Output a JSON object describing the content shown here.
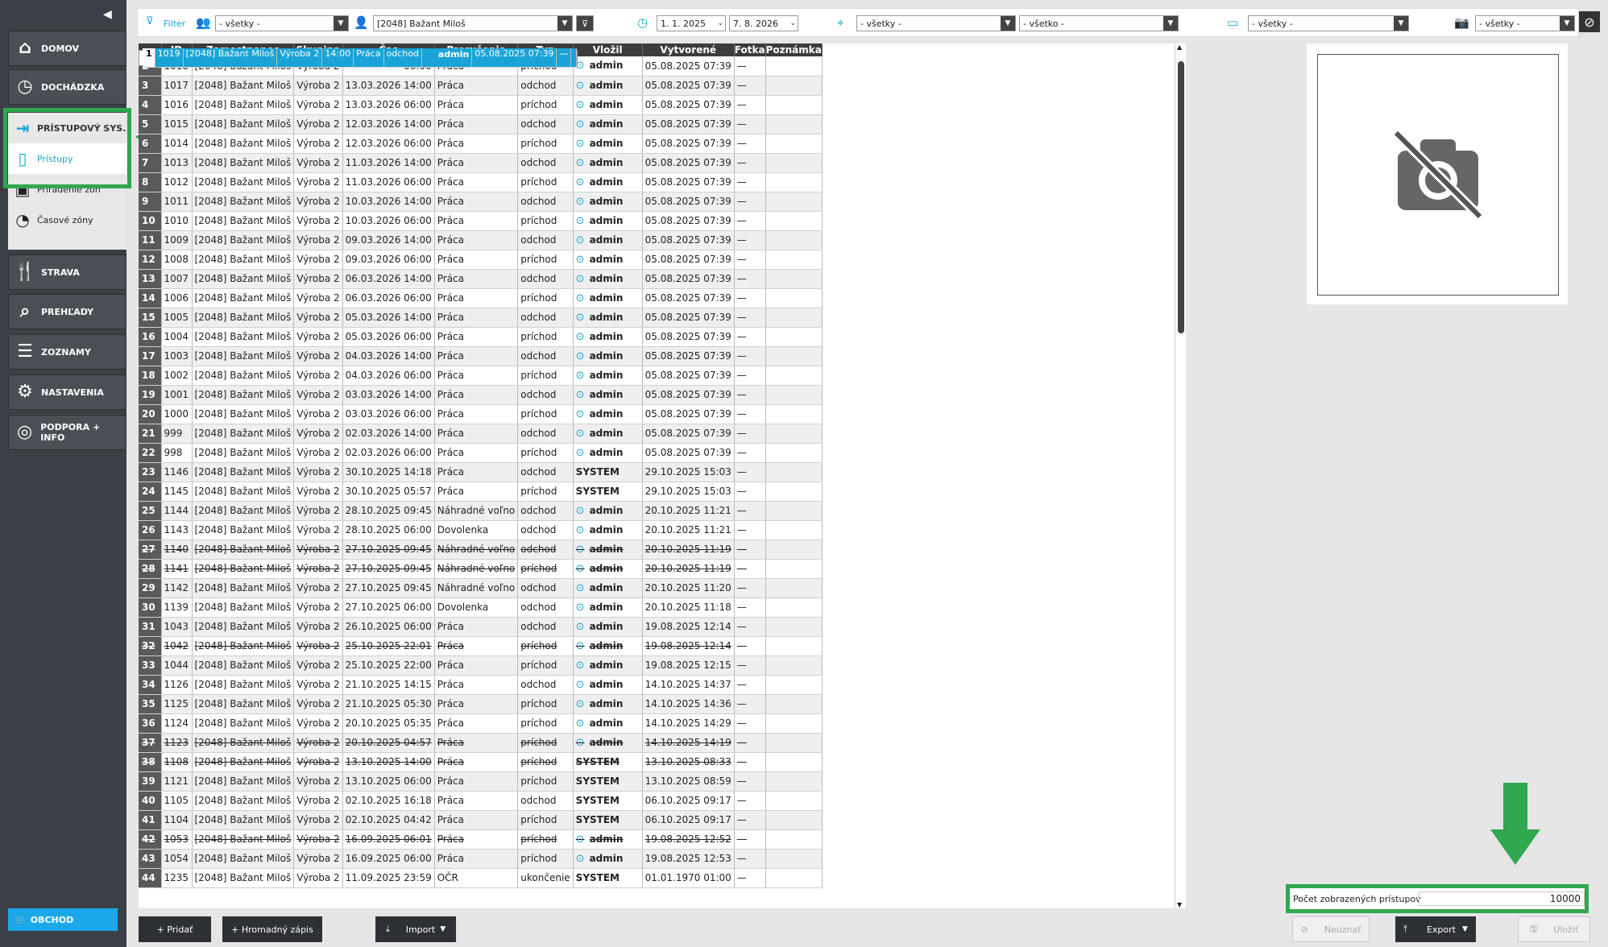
{
  "nav": {
    "domov": "DOMOV",
    "dochadzka": "DOCHÁDZKA",
    "pristupovy": "PRÍSTUPOVÝ SYS.",
    "pristupy": "Prístupy",
    "priradenie": "Priradenie zón",
    "casove": "Časové zóny",
    "strava": "STRAVA",
    "prehlady": "PREHĽADY",
    "zoznamy": "ZOZNAMY",
    "nastavenia": "NASTAVENIA",
    "podpora": "PODPORA + INFO",
    "obchod": "OBCHOD"
  },
  "toolbar": {
    "filter": "Filter",
    "group": "- všetky -",
    "employee": "[2048] Bažant Miloš",
    "date_from": "1. 1. 2025",
    "date_to": "7. 8. 2026",
    "zone1": "- všetky -",
    "zone2": "- všetko -",
    "device": "- všetky -",
    "photo": "- všetky -"
  },
  "columns": [
    "ID",
    "Zamestnanec",
    "Skupina",
    "Čas",
    "Prerušenie",
    "Typ",
    "Vložil",
    "Vytvorené",
    "Fotka",
    "Poznámka"
  ],
  "rows": [
    [
      "1",
      "1019",
      "[2048] Bažant Miloš",
      "Výroba 2",
      "14:00",
      "Práca",
      "odchod",
      "admin",
      "05.08.2025 07:39",
      "—",
      "sel"
    ],
    [
      "2",
      "1018",
      "[2048] Bažant Miloš",
      "Výroba 2",
      "06:00",
      "Práca",
      "príchod",
      "admin",
      "05.08.2025 07:39",
      "—",
      ""
    ],
    [
      "3",
      "1017",
      "[2048] Bažant Miloš",
      "Výroba 2",
      "13.03.2026 14:00",
      "Práca",
      "odchod",
      "admin",
      "05.08.2025 07:39",
      "—",
      ""
    ],
    [
      "4",
      "1016",
      "[2048] Bažant Miloš",
      "Výroba 2",
      "13.03.2026 06:00",
      "Práca",
      "príchod",
      "admin",
      "05.08.2025 07:39",
      "—",
      ""
    ],
    [
      "5",
      "1015",
      "[2048] Bažant Miloš",
      "Výroba 2",
      "12.03.2026 14:00",
      "Práca",
      "odchod",
      "admin",
      "05.08.2025 07:39",
      "—",
      ""
    ],
    [
      "6",
      "1014",
      "[2048] Bažant Miloš",
      "Výroba 2",
      "12.03.2026 06:00",
      "Práca",
      "príchod",
      "admin",
      "05.08.2025 07:39",
      "—",
      ""
    ],
    [
      "7",
      "1013",
      "[2048] Bažant Miloš",
      "Výroba 2",
      "11.03.2026 14:00",
      "Práca",
      "odchod",
      "admin",
      "05.08.2025 07:39",
      "—",
      ""
    ],
    [
      "8",
      "1012",
      "[2048] Bažant Miloš",
      "Výroba 2",
      "11.03.2026 06:00",
      "Práca",
      "príchod",
      "admin",
      "05.08.2025 07:39",
      "—",
      ""
    ],
    [
      "9",
      "1011",
      "[2048] Bažant Miloš",
      "Výroba 2",
      "10.03.2026 14:00",
      "Práca",
      "odchod",
      "admin",
      "05.08.2025 07:39",
      "—",
      ""
    ],
    [
      "10",
      "1010",
      "[2048] Bažant Miloš",
      "Výroba 2",
      "10.03.2026 06:00",
      "Práca",
      "príchod",
      "admin",
      "05.08.2025 07:39",
      "—",
      ""
    ],
    [
      "11",
      "1009",
      "[2048] Bažant Miloš",
      "Výroba 2",
      "09.03.2026 14:00",
      "Práca",
      "odchod",
      "admin",
      "05.08.2025 07:39",
      "—",
      ""
    ],
    [
      "12",
      "1008",
      "[2048] Bažant Miloš",
      "Výroba 2",
      "09.03.2026 06:00",
      "Práca",
      "príchod",
      "admin",
      "05.08.2025 07:39",
      "—",
      ""
    ],
    [
      "13",
      "1007",
      "[2048] Bažant Miloš",
      "Výroba 2",
      "06.03.2026 14:00",
      "Práca",
      "odchod",
      "admin",
      "05.08.2025 07:39",
      "—",
      ""
    ],
    [
      "14",
      "1006",
      "[2048] Bažant Miloš",
      "Výroba 2",
      "06.03.2026 06:00",
      "Práca",
      "príchod",
      "admin",
      "05.08.2025 07:39",
      "—",
      ""
    ],
    [
      "15",
      "1005",
      "[2048] Bažant Miloš",
      "Výroba 2",
      "05.03.2026 14:00",
      "Práca",
      "odchod",
      "admin",
      "05.08.2025 07:39",
      "—",
      ""
    ],
    [
      "16",
      "1004",
      "[2048] Bažant Miloš",
      "Výroba 2",
      "05.03.2026 06:00",
      "Práca",
      "príchod",
      "admin",
      "05.08.2025 07:39",
      "—",
      ""
    ],
    [
      "17",
      "1003",
      "[2048] Bažant Miloš",
      "Výroba 2",
      "04.03.2026 14:00",
      "Práca",
      "odchod",
      "admin",
      "05.08.2025 07:39",
      "—",
      ""
    ],
    [
      "18",
      "1002",
      "[2048] Bažant Miloš",
      "Výroba 2",
      "04.03.2026 06:00",
      "Práca",
      "príchod",
      "admin",
      "05.08.2025 07:39",
      "—",
      ""
    ],
    [
      "19",
      "1001",
      "[2048] Bažant Miloš",
      "Výroba 2",
      "03.03.2026 14:00",
      "Práca",
      "odchod",
      "admin",
      "05.08.2025 07:39",
      "—",
      ""
    ],
    [
      "20",
      "1000",
      "[2048] Bažant Miloš",
      "Výroba 2",
      "03.03.2026 06:00",
      "Práca",
      "príchod",
      "admin",
      "05.08.2025 07:39",
      "—",
      ""
    ],
    [
      "21",
      "999",
      "[2048] Bažant Miloš",
      "Výroba 2",
      "02.03.2026 14:00",
      "Práca",
      "odchod",
      "admin",
      "05.08.2025 07:39",
      "—",
      ""
    ],
    [
      "22",
      "998",
      "[2048] Bažant Miloš",
      "Výroba 2",
      "02.03.2026 06:00",
      "Práca",
      "príchod",
      "admin",
      "05.08.2025 07:39",
      "—",
      ""
    ],
    [
      "23",
      "1146",
      "[2048] Bažant Miloš",
      "Výroba 2",
      "30.10.2025 14:18",
      "Práca",
      "odchod",
      "SYSTEM",
      "29.10.2025 15:03",
      "—",
      "sys"
    ],
    [
      "24",
      "1145",
      "[2048] Bažant Miloš",
      "Výroba 2",
      "30.10.2025 05:57",
      "Práca",
      "príchod",
      "SYSTEM",
      "29.10.2025 15:03",
      "—",
      "sys"
    ],
    [
      "25",
      "1144",
      "[2048] Bažant Miloš",
      "Výroba 2",
      "28.10.2025 09:45",
      "Náhradné voľno",
      "odchod",
      "admin",
      "20.10.2025 11:21",
      "—",
      ""
    ],
    [
      "26",
      "1143",
      "[2048] Bažant Miloš",
      "Výroba 2",
      "28.10.2025 06:00",
      "Dovolenka",
      "odchod",
      "admin",
      "20.10.2025 11:21",
      "—",
      ""
    ],
    [
      "27",
      "1140",
      "[2048] Bažant Miloš",
      "Výroba 2",
      "27.10.2025 09:45",
      "Náhradné voľno",
      "odchod",
      "admin",
      "20.10.2025 11:19",
      "—",
      "strike"
    ],
    [
      "28",
      "1141",
      "[2048] Bažant Miloš",
      "Výroba 2",
      "27.10.2025 09:45",
      "Náhradné voľno",
      "príchod",
      "admin",
      "20.10.2025 11:19",
      "—",
      "strike"
    ],
    [
      "29",
      "1142",
      "[2048] Bažant Miloš",
      "Výroba 2",
      "27.10.2025 09:45",
      "Náhradné voľno",
      "odchod",
      "admin",
      "20.10.2025 11:20",
      "—",
      ""
    ],
    [
      "30",
      "1139",
      "[2048] Bažant Miloš",
      "Výroba 2",
      "27.10.2025 06:00",
      "Dovolenka",
      "odchod",
      "admin",
      "20.10.2025 11:18",
      "—",
      ""
    ],
    [
      "31",
      "1043",
      "[2048] Bažant Miloš",
      "Výroba 2",
      "26.10.2025 06:00",
      "Práca",
      "odchod",
      "admin",
      "19.08.2025 12:14",
      "—",
      ""
    ],
    [
      "32",
      "1042",
      "[2048] Bažant Miloš",
      "Výroba 2",
      "25.10.2025 22:01",
      "Práca",
      "príchod",
      "admin",
      "19.08.2025 12:14",
      "—",
      "strike"
    ],
    [
      "33",
      "1044",
      "[2048] Bažant Miloš",
      "Výroba 2",
      "25.10.2025 22:00",
      "Práca",
      "príchod",
      "admin",
      "19.08.2025 12:15",
      "—",
      ""
    ],
    [
      "34",
      "1126",
      "[2048] Bažant Miloš",
      "Výroba 2",
      "21.10.2025 14:15",
      "Práca",
      "odchod",
      "admin",
      "14.10.2025 14:37",
      "—",
      ""
    ],
    [
      "35",
      "1125",
      "[2048] Bažant Miloš",
      "Výroba 2",
      "21.10.2025 05:30",
      "Práca",
      "príchod",
      "admin",
      "14.10.2025 14:36",
      "—",
      ""
    ],
    [
      "36",
      "1124",
      "[2048] Bažant Miloš",
      "Výroba 2",
      "20.10.2025 05:35",
      "Práca",
      "príchod",
      "admin",
      "14.10.2025 14:29",
      "—",
      ""
    ],
    [
      "37",
      "1123",
      "[2048] Bažant Miloš",
      "Výroba 2",
      "20.10.2025 04:57",
      "Práca",
      "príchod",
      "admin",
      "14.10.2025 14:19",
      "—",
      "strike"
    ],
    [
      "38",
      "1108",
      "[2048] Bažant Miloš",
      "Výroba 2",
      "13.10.2025 14:00",
      "Práca",
      "príchod",
      "SYSTEM",
      "13.10.2025 08:33",
      "—",
      "strike sys"
    ],
    [
      "39",
      "1121",
      "[2048] Bažant Miloš",
      "Výroba 2",
      "13.10.2025 06:00",
      "Práca",
      "príchod",
      "SYSTEM",
      "13.10.2025 08:59",
      "—",
      "sys"
    ],
    [
      "40",
      "1105",
      "[2048] Bažant Miloš",
      "Výroba 2",
      "02.10.2025 16:18",
      "Práca",
      "odchod",
      "SYSTEM",
      "06.10.2025 09:17",
      "—",
      "sys"
    ],
    [
      "41",
      "1104",
      "[2048] Bažant Miloš",
      "Výroba 2",
      "02.10.2025 04:42",
      "Práca",
      "príchod",
      "SYSTEM",
      "06.10.2025 09:17",
      "—",
      "sys"
    ],
    [
      "42",
      "1053",
      "[2048] Bažant Miloš",
      "Výroba 2",
      "16.09.2025 06:01",
      "Práca",
      "príchod",
      "admin",
      "19.08.2025 12:52",
      "—",
      "strike"
    ],
    [
      "43",
      "1054",
      "[2048] Bažant Miloš",
      "Výroba 2",
      "16.09.2025 06:00",
      "Práca",
      "príchod",
      "admin",
      "19.08.2025 12:53",
      "—",
      ""
    ],
    [
      "44",
      "1235",
      "[2048] Bažant Miloš",
      "Výroba 2",
      "11.09.2025 23:59",
      "OČR",
      "ukončenie",
      "SYSTEM",
      "01.01.1970 01:00",
      "—",
      "sys"
    ]
  ],
  "buttons": {
    "pridat": "+ Pridať",
    "hromadny": "+ Hromadný zápis",
    "import": "Import",
    "neuznat": "Neuznať",
    "export": "Export",
    "ulozit": "Uložiť"
  },
  "count": {
    "label": "Počet zobrazených prístupov",
    "value": "10000"
  },
  "colors": {
    "accent": "#1aa3d6",
    "highlight": "#2fa84f"
  }
}
